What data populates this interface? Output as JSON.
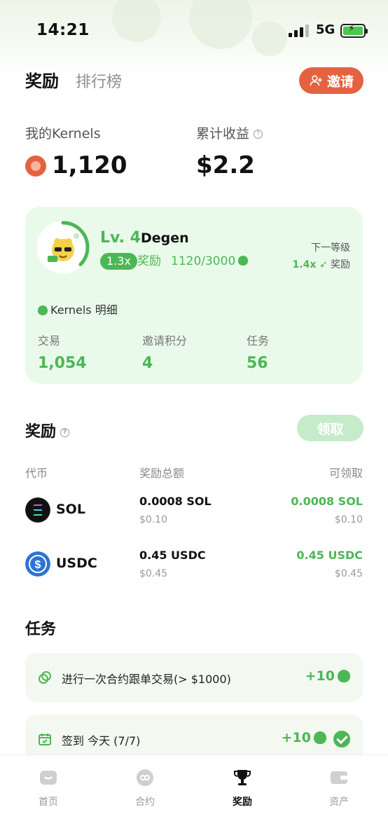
{
  "status_bar": {
    "time": "14:21",
    "network": "5G"
  },
  "header": {
    "tabs": [
      {
        "label": "奖励"
      },
      {
        "label": "排行榜"
      }
    ],
    "invite_label": "邀请"
  },
  "summary": {
    "kernels_label": "我的Kernels",
    "kernels_value": "1,120",
    "earnings_label": "累计收益",
    "earnings_value": "$2.2"
  },
  "level_card": {
    "level": "Lv. 4",
    "name": "Degen",
    "multiplier": "1.3x",
    "multiplier_label": "奖励",
    "progress": "1120/3000",
    "progress_fraction": 0.373,
    "next_level_label": "下一等级",
    "next_multiplier": "1.4x",
    "next_reward_label": "奖励",
    "detail_title": "Kernels 明细",
    "breakdown": [
      {
        "label": "交易",
        "value": "1,054"
      },
      {
        "label": "邀请积分",
        "value": "4"
      },
      {
        "label": "任务",
        "value": "56"
      }
    ]
  },
  "rewards": {
    "title": "奖励",
    "claim_label": "领取",
    "columns": {
      "token": "代币",
      "total": "奖励总额",
      "claimable": "可领取"
    },
    "rows": [
      {
        "token": "SOL",
        "amount": "0.0008 SOL",
        "amount_usd": "$0.10",
        "claimable": "0.0008 SOL",
        "claimable_usd": "$0.10"
      },
      {
        "token": "USDC",
        "amount": "0.45 USDC",
        "amount_usd": "$0.45",
        "claimable": "0.45 USDC",
        "claimable_usd": "$0.45"
      }
    ]
  },
  "tasks": {
    "title": "任务",
    "items": [
      {
        "text": "进行一次合约跟单交易(> $1000)",
        "points": "+10",
        "completed": false
      },
      {
        "text": "签到 今天 (7/7)",
        "points": "+10",
        "completed": true
      }
    ]
  },
  "bottom_nav": [
    {
      "label": "首页",
      "active": false
    },
    {
      "label": "合约",
      "active": false
    },
    {
      "label": "奖励",
      "active": true
    },
    {
      "label": "资产",
      "active": false
    }
  ],
  "colors": {
    "accent_green": "#4cb755",
    "invite_orange": "#e4623f",
    "card_bg": "#eafaea"
  }
}
